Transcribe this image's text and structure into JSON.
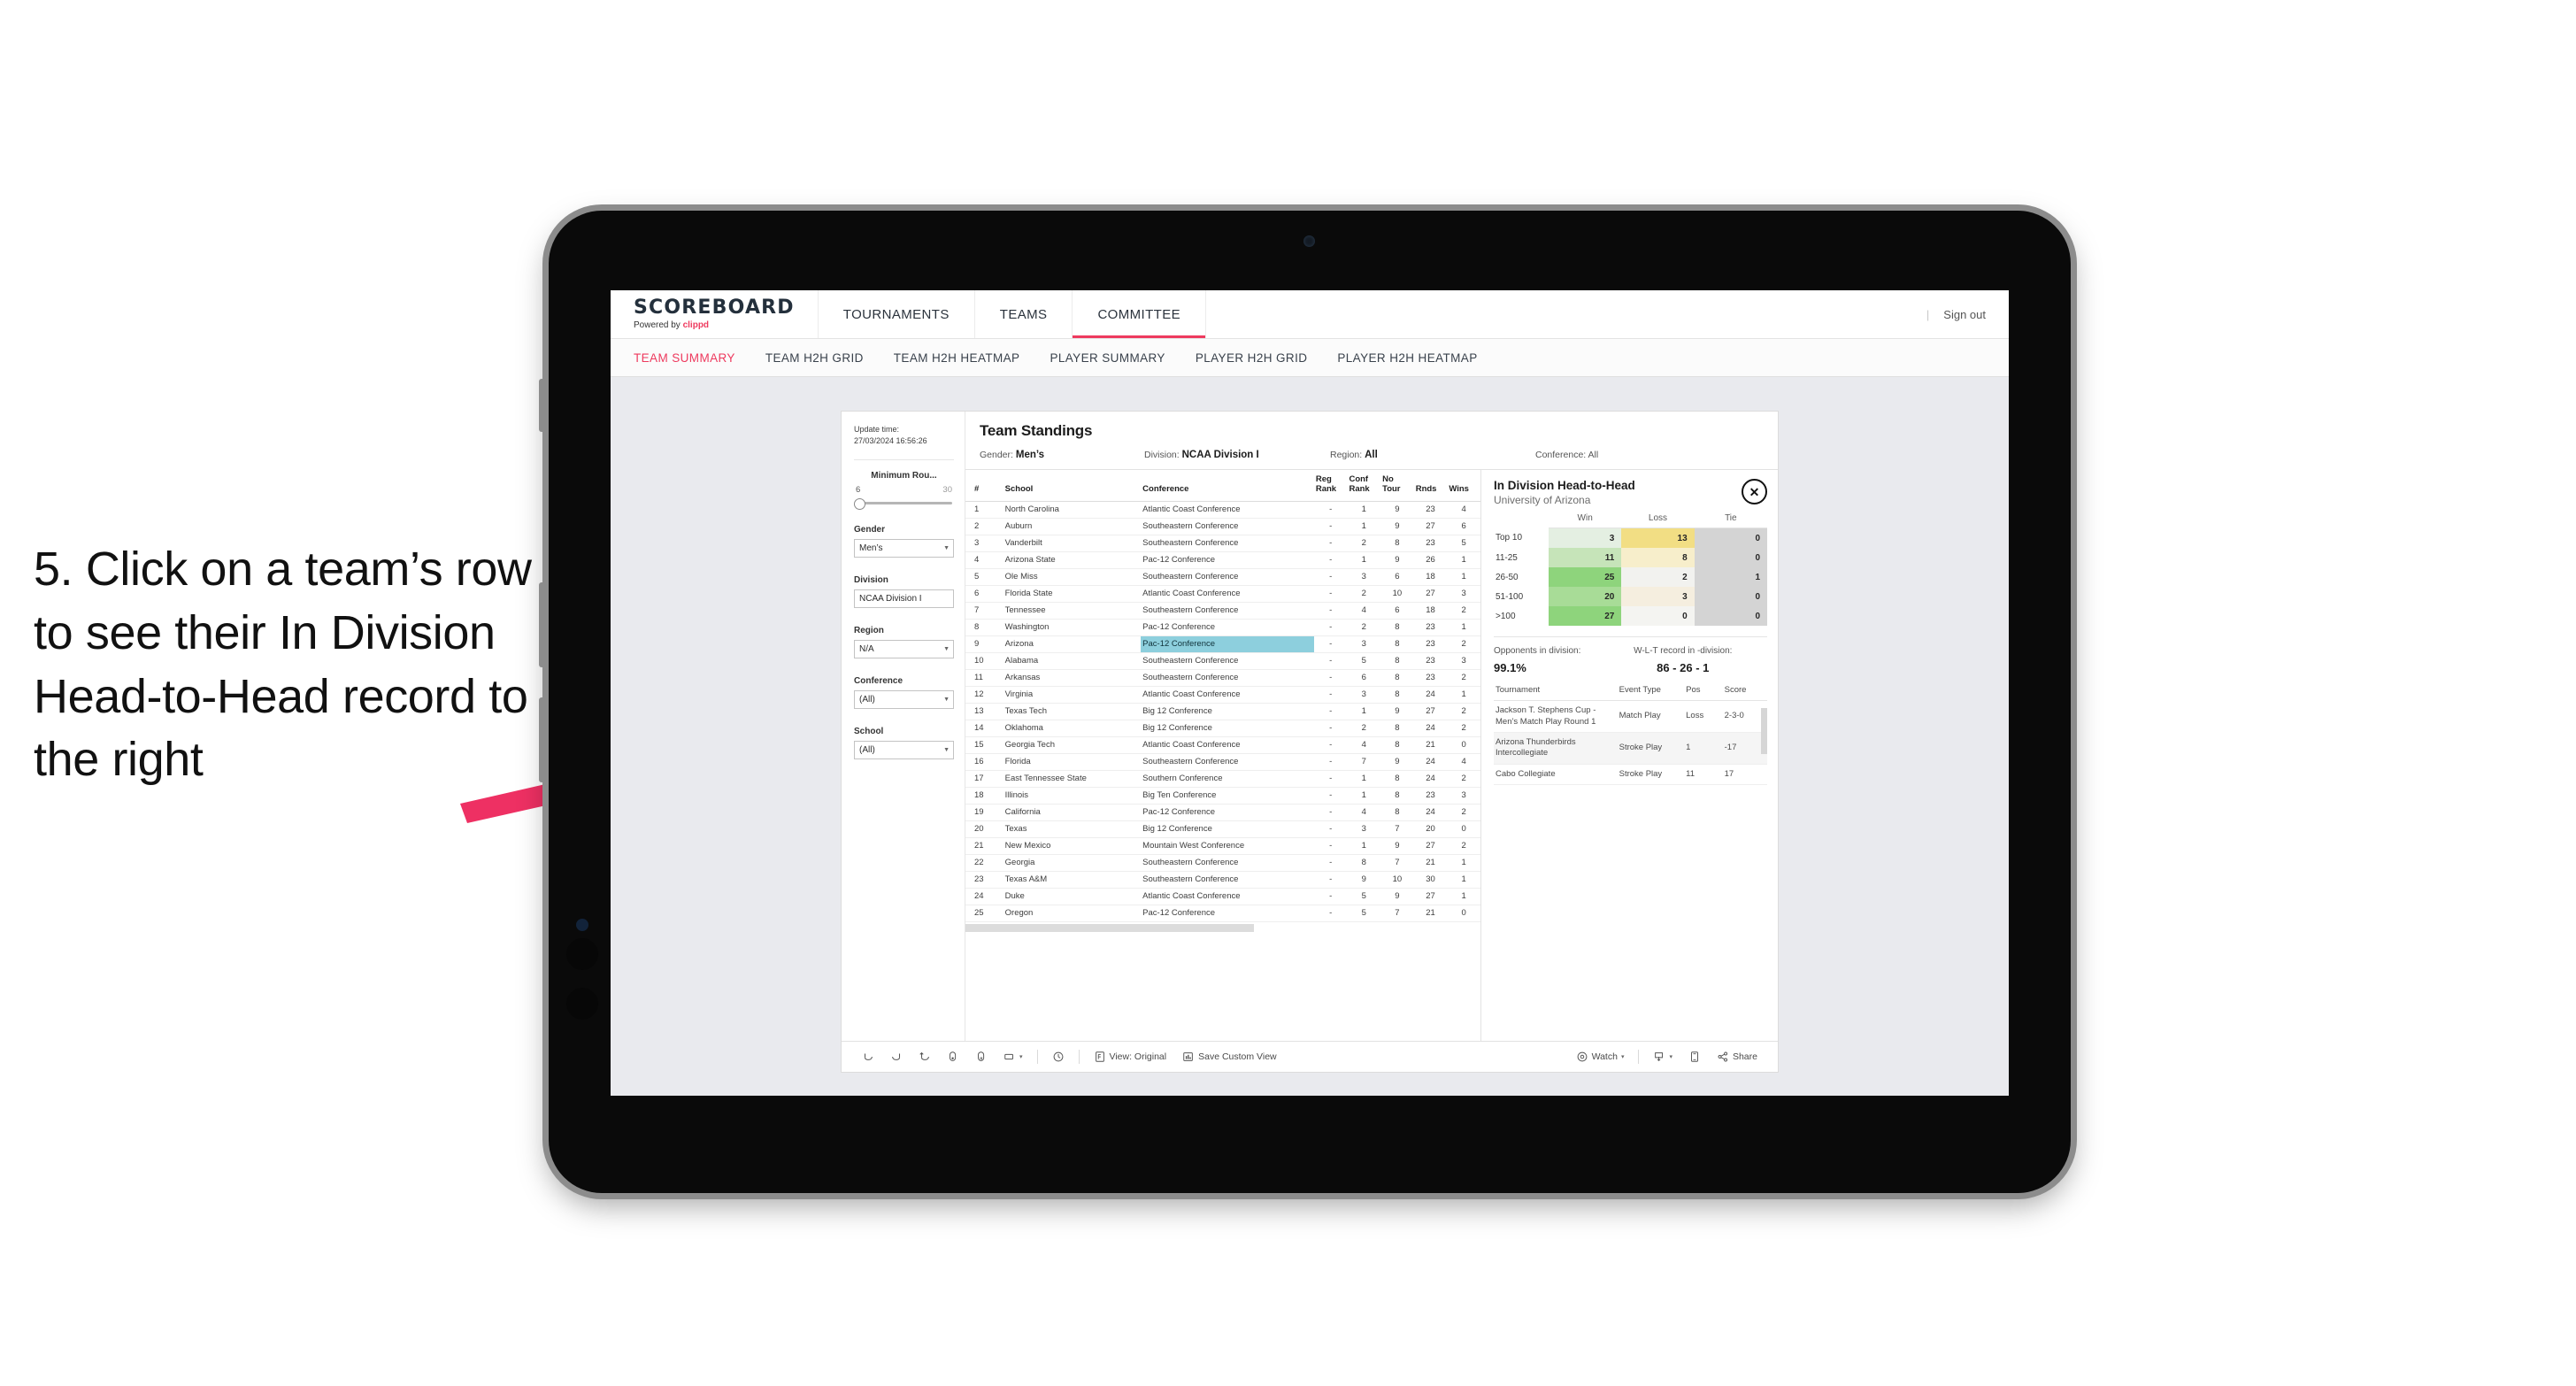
{
  "annotation": {
    "text": "5. Click on a team’s row to see their In Division Head-to-Head record to the right",
    "arrow_color": "#ee3063"
  },
  "app": {
    "brand": {
      "name": "SCOREBOARD",
      "powered_prefix": "Powered by ",
      "powered_brand": "clippd"
    },
    "nav": [
      {
        "label": "TOURNAMENTS",
        "active": false
      },
      {
        "label": "TEAMS",
        "active": false
      },
      {
        "label": "COMMITTEE",
        "active": true
      }
    ],
    "topbar_right": {
      "divider": "|",
      "sign_out": "Sign out"
    },
    "subtabs": [
      {
        "label": "TEAM SUMMARY",
        "active": true
      },
      {
        "label": "TEAM H2H GRID",
        "active": false
      },
      {
        "label": "TEAM H2H HEATMAP",
        "active": false
      },
      {
        "label": "PLAYER SUMMARY",
        "active": false
      },
      {
        "label": "PLAYER H2H GRID",
        "active": false
      },
      {
        "label": "PLAYER H2H HEATMAP",
        "active": false
      }
    ]
  },
  "filters": {
    "update_label": "Update time:",
    "update_value": "27/03/2024 16:56:26",
    "min_rounds": {
      "label": "Minimum Rou...",
      "min": "6",
      "max": "30"
    },
    "gender": {
      "label": "Gender",
      "value": "Men’s"
    },
    "division": {
      "label": "Division",
      "value": "NCAA Division I"
    },
    "region": {
      "label": "Region",
      "value": "N/A"
    },
    "conference": {
      "label": "Conference",
      "value": "(All)"
    },
    "school": {
      "label": "School",
      "value": "(All)"
    }
  },
  "standings": {
    "title": "Team Standings",
    "meta": {
      "gender_label": "Gender: ",
      "gender_value": "Men’s",
      "division_label": "Division: ",
      "division_value": "NCAA Division I",
      "region_label": "Region: ",
      "region_value": "All",
      "conference_label": "Conference: ",
      "conference_value": "All"
    },
    "columns": [
      "#",
      "School",
      "Conference",
      "Reg Rank",
      "Conf Rank",
      "No Tour",
      "Rnds",
      "Wins"
    ],
    "column_head_lines": [
      [
        "#"
      ],
      [
        "School"
      ],
      [
        "Conference"
      ],
      [
        "Reg",
        "Rank"
      ],
      [
        "Conf",
        "Rank"
      ],
      [
        "No",
        "Tour"
      ],
      [
        "Rnds"
      ],
      [
        "Wins"
      ]
    ],
    "selected_row": 9,
    "rows": [
      {
        "n": "1",
        "school": "North Carolina",
        "conf": "Atlantic Coast Conference",
        "reg": "-",
        "cr": "1",
        "nt": "9",
        "rnds": "23",
        "wins": "4"
      },
      {
        "n": "2",
        "school": "Auburn",
        "conf": "Southeastern Conference",
        "reg": "-",
        "cr": "1",
        "nt": "9",
        "rnds": "27",
        "wins": "6"
      },
      {
        "n": "3",
        "school": "Vanderbilt",
        "conf": "Southeastern Conference",
        "reg": "-",
        "cr": "2",
        "nt": "8",
        "rnds": "23",
        "wins": "5"
      },
      {
        "n": "4",
        "school": "Arizona State",
        "conf": "Pac-12 Conference",
        "reg": "-",
        "cr": "1",
        "nt": "9",
        "rnds": "26",
        "wins": "1"
      },
      {
        "n": "5",
        "school": "Ole Miss",
        "conf": "Southeastern Conference",
        "reg": "-",
        "cr": "3",
        "nt": "6",
        "rnds": "18",
        "wins": "1"
      },
      {
        "n": "6",
        "school": "Florida State",
        "conf": "Atlantic Coast Conference",
        "reg": "-",
        "cr": "2",
        "nt": "10",
        "rnds": "27",
        "wins": "3"
      },
      {
        "n": "7",
        "school": "Tennessee",
        "conf": "Southeastern Conference",
        "reg": "-",
        "cr": "4",
        "nt": "6",
        "rnds": "18",
        "wins": "2"
      },
      {
        "n": "8",
        "school": "Washington",
        "conf": "Pac-12 Conference",
        "reg": "-",
        "cr": "2",
        "nt": "8",
        "rnds": "23",
        "wins": "1"
      },
      {
        "n": "9",
        "school": "Arizona",
        "conf": "Pac-12 Conference",
        "reg": "-",
        "cr": "3",
        "nt": "8",
        "rnds": "23",
        "wins": "2"
      },
      {
        "n": "10",
        "school": "Alabama",
        "conf": "Southeastern Conference",
        "reg": "-",
        "cr": "5",
        "nt": "8",
        "rnds": "23",
        "wins": "3"
      },
      {
        "n": "11",
        "school": "Arkansas",
        "conf": "Southeastern Conference",
        "reg": "-",
        "cr": "6",
        "nt": "8",
        "rnds": "23",
        "wins": "2"
      },
      {
        "n": "12",
        "school": "Virginia",
        "conf": "Atlantic Coast Conference",
        "reg": "-",
        "cr": "3",
        "nt": "8",
        "rnds": "24",
        "wins": "1"
      },
      {
        "n": "13",
        "school": "Texas Tech",
        "conf": "Big 12 Conference",
        "reg": "-",
        "cr": "1",
        "nt": "9",
        "rnds": "27",
        "wins": "2"
      },
      {
        "n": "14",
        "school": "Oklahoma",
        "conf": "Big 12 Conference",
        "reg": "-",
        "cr": "2",
        "nt": "8",
        "rnds": "24",
        "wins": "2"
      },
      {
        "n": "15",
        "school": "Georgia Tech",
        "conf": "Atlantic Coast Conference",
        "reg": "-",
        "cr": "4",
        "nt": "8",
        "rnds": "21",
        "wins": "0"
      },
      {
        "n": "16",
        "school": "Florida",
        "conf": "Southeastern Conference",
        "reg": "-",
        "cr": "7",
        "nt": "9",
        "rnds": "24",
        "wins": "4"
      },
      {
        "n": "17",
        "school": "East Tennessee State",
        "conf": "Southern Conference",
        "reg": "-",
        "cr": "1",
        "nt": "8",
        "rnds": "24",
        "wins": "2"
      },
      {
        "n": "18",
        "school": "Illinois",
        "conf": "Big Ten Conference",
        "reg": "-",
        "cr": "1",
        "nt": "8",
        "rnds": "23",
        "wins": "3"
      },
      {
        "n": "19",
        "school": "California",
        "conf": "Pac-12 Conference",
        "reg": "-",
        "cr": "4",
        "nt": "8",
        "rnds": "24",
        "wins": "2"
      },
      {
        "n": "20",
        "school": "Texas",
        "conf": "Big 12 Conference",
        "reg": "-",
        "cr": "3",
        "nt": "7",
        "rnds": "20",
        "wins": "0"
      },
      {
        "n": "21",
        "school": "New Mexico",
        "conf": "Mountain West Conference",
        "reg": "-",
        "cr": "1",
        "nt": "9",
        "rnds": "27",
        "wins": "2"
      },
      {
        "n": "22",
        "school": "Georgia",
        "conf": "Southeastern Conference",
        "reg": "-",
        "cr": "8",
        "nt": "7",
        "rnds": "21",
        "wins": "1"
      },
      {
        "n": "23",
        "school": "Texas A&M",
        "conf": "Southeastern Conference",
        "reg": "-",
        "cr": "9",
        "nt": "10",
        "rnds": "30",
        "wins": "1"
      },
      {
        "n": "24",
        "school": "Duke",
        "conf": "Atlantic Coast Conference",
        "reg": "-",
        "cr": "5",
        "nt": "9",
        "rnds": "27",
        "wins": "1"
      },
      {
        "n": "25",
        "school": "Oregon",
        "conf": "Pac-12 Conference",
        "reg": "-",
        "cr": "5",
        "nt": "7",
        "rnds": "21",
        "wins": "0"
      }
    ]
  },
  "h2h": {
    "title": "In Division Head-to-Head",
    "subtitle": "University of Arizona",
    "close_icon": "✕",
    "chart_data": {
      "type": "heatmap",
      "title": "In Division Head-to-Head",
      "subtitle": "University of Arizona",
      "columns": [
        "Win",
        "Loss",
        "Tie"
      ],
      "rows": [
        "Top 10",
        "11-25",
        "26-50",
        "51-100",
        ">100"
      ],
      "values": [
        [
          3,
          13,
          0
        ],
        [
          11,
          8,
          0
        ],
        [
          25,
          2,
          1
        ],
        [
          20,
          3,
          0
        ],
        [
          27,
          0,
          0
        ]
      ],
      "colors": [
        [
          "#e4efe2",
          "#f2de84",
          "#d4d4d4"
        ],
        [
          "#c6e4b9",
          "#f7eecb",
          "#d4d4d4"
        ],
        [
          "#8ed47c",
          "#f2f2ef",
          "#d4d4d4"
        ],
        [
          "#a8dc97",
          "#f5eedf",
          "#d4d4d4"
        ],
        [
          "#8ed47c",
          "#f4f4f1",
          "#d4d4d4"
        ]
      ]
    },
    "stats": [
      {
        "label": "Opponents in division:",
        "value": "99.1%"
      },
      {
        "label": "W-L-T record in -division:",
        "value": "86 - 26 - 1"
      }
    ],
    "tournaments": {
      "columns": [
        "Tournament",
        "Event Type",
        "Pos",
        "Score"
      ],
      "rows": [
        {
          "name": "Jackson T. Stephens Cup - Men’s Match Play Round 1",
          "type": "Match Play",
          "pos": "Loss",
          "score": "2-3-0"
        },
        {
          "name": "Arizona Thunderbirds Intercollegiate",
          "type": "Stroke Play",
          "pos": "1",
          "score": "-17"
        },
        {
          "name": "Cabo Collegiate",
          "type": "Stroke Play",
          "pos": "11",
          "score": "17"
        }
      ]
    }
  },
  "toolbar": {
    "view_label": "View: Original",
    "save_label": "Save Custom View",
    "watch_label": "Watch",
    "share_label": "Share",
    "caret": "▾"
  }
}
